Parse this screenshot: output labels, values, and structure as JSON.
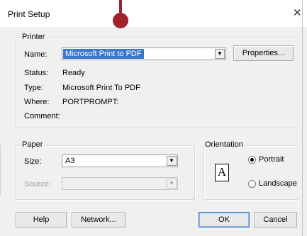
{
  "window": {
    "title": "Print Setup"
  },
  "printer": {
    "group_label": "Printer",
    "name_label": "Name:",
    "name_value": "Microsoft Print to PDF",
    "properties_button": "Properties...",
    "status_label": "Status:",
    "status_value": "Ready",
    "type_label": "Type:",
    "type_value": "Microsoft Print To PDF",
    "where_label": "Where:",
    "where_value": "PORTPROMPT:",
    "comment_label": "Comment:",
    "comment_value": ""
  },
  "paper": {
    "group_label": "Paper",
    "size_label": "Size:",
    "size_value": "A3",
    "source_label": "Source:",
    "source_value": ""
  },
  "orientation": {
    "group_label": "Orientation",
    "portrait_label": "Portrait",
    "landscape_label": "Landscape",
    "selected": "portrait",
    "icon_letter": "A"
  },
  "buttons": {
    "help": "Help",
    "network": "Network...",
    "ok": "OK",
    "cancel": "Cancel"
  },
  "icons": [
    "close-icon",
    "dropdown-arrow-icon",
    "portrait-page-icon"
  ],
  "colors": {
    "selection": "#3a78c9",
    "marker": "#a0232e"
  }
}
